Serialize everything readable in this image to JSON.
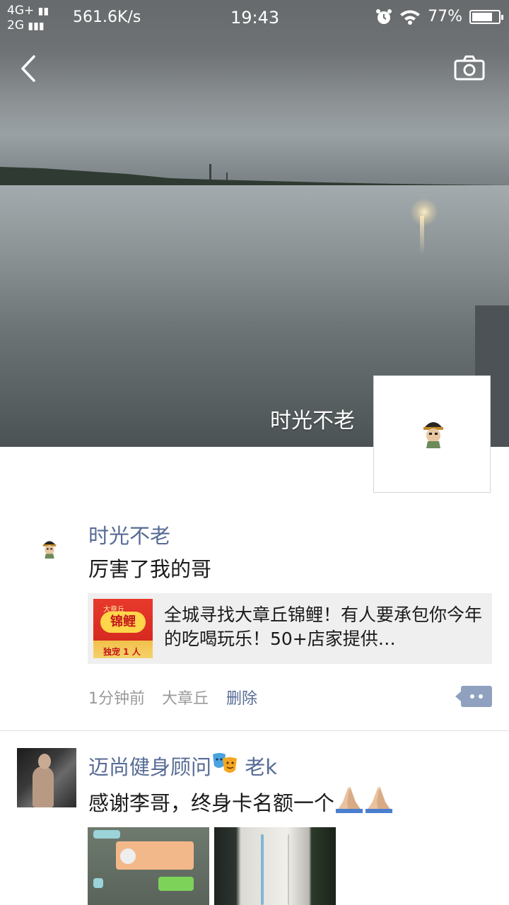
{
  "status_bar": {
    "network_top": "4G+",
    "network_bottom": "2G",
    "speed": "561.6K/s",
    "time": "19:43",
    "battery": "77%",
    "battery_level": 0.77
  },
  "cover": {
    "owner_name": "时光不老"
  },
  "icons": {
    "back": "chevron-left-icon",
    "camera": "camera-icon",
    "alarm": "alarm-icon",
    "wifi": "wifi-icon",
    "comment": "comment-more-icon"
  },
  "colors": {
    "name_link": "#576b95",
    "meta_grey": "#9a9a9a",
    "comment_button": "#8fa1bf"
  },
  "posts": [
    {
      "author": "时光不老",
      "text": "厉害了我的哥",
      "link": {
        "thumb_top": "大章丘",
        "thumb_main": "锦鲤",
        "thumb_bottom": "独宠 1 人",
        "title": "全城寻找大章丘锦鲤！有人要承包你今年的吃喝玩乐！50+店家提供…"
      },
      "time": "1分钟前",
      "location": "大章丘",
      "delete": "删除"
    },
    {
      "author_prefix": "迈尚健身顾问",
      "author_suffix": "老k",
      "author_emoji": "theater-masks-emoji",
      "text": "感谢李哥，终身卡名额一个",
      "text_emoji": "folded-hands-emoji"
    }
  ]
}
